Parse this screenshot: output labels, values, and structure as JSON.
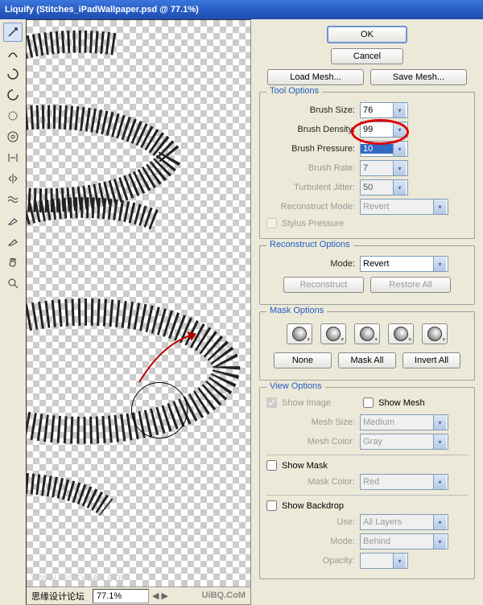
{
  "window": {
    "title": "Liquify (Stitches_iPadWallpaper.psd @ 77.1%)"
  },
  "buttons": {
    "ok": "OK",
    "cancel": "Cancel",
    "loadMesh": "Load Mesh...",
    "saveMesh": "Save Mesh..."
  },
  "toolOptions": {
    "legend": "Tool Options",
    "brushSize": {
      "label": "Brush Size:",
      "value": "76"
    },
    "brushDensity": {
      "label": "Brush Density:",
      "value": "99"
    },
    "brushPressure": {
      "label": "Brush Pressure:",
      "value": "10"
    },
    "brushRate": {
      "label": "Brush Rate:",
      "value": "7"
    },
    "turbulentJitter": {
      "label": "Turbulent Jitter:",
      "value": "50"
    },
    "reconstructMode": {
      "label": "Reconstruct Mode:",
      "value": "Revert"
    },
    "stylusPressure": "Stylus Pressure"
  },
  "reconstructOptions": {
    "legend": "Reconstruct Options",
    "mode": {
      "label": "Mode:",
      "value": "Revert"
    },
    "reconstruct": "Reconstruct",
    "restoreAll": "Restore All"
  },
  "maskOptions": {
    "legend": "Mask Options",
    "none": "None",
    "maskAll": "Mask All",
    "invertAll": "Invert All"
  },
  "viewOptions": {
    "legend": "View Options",
    "showImage": "Show Image",
    "showMesh": "Show Mesh",
    "meshSize": {
      "label": "Mesh Size:",
      "value": "Medium"
    },
    "meshColor": {
      "label": "Mesh Color:",
      "value": "Gray"
    },
    "showMask": "Show Mask",
    "maskColor": {
      "label": "Mask Color:",
      "value": "Red"
    },
    "showBackdrop": "Show Backdrop",
    "use": {
      "label": "Use:",
      "value": "All Layers"
    },
    "mode": {
      "label": "Mode:",
      "value": "Behind"
    },
    "opacity": {
      "label": "Opacity:",
      "value": ""
    }
  },
  "status": {
    "zoom": "77.1%",
    "left": "思缘设计论坛",
    "watermark": "WWW.MISSYUAN.COM",
    "brand": "UiBQ.CoM"
  }
}
